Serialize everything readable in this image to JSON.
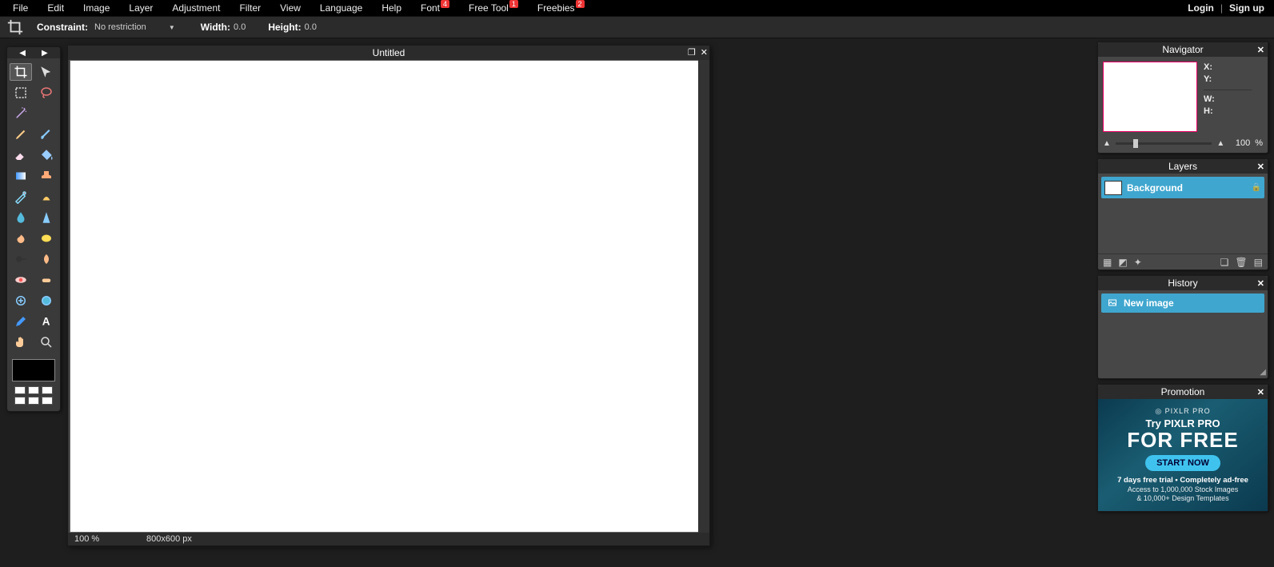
{
  "menu": {
    "items": [
      "File",
      "Edit",
      "Image",
      "Layer",
      "Adjustment",
      "Filter",
      "View",
      "Language",
      "Help"
    ],
    "font_label": "Font",
    "font_badge": "4",
    "freetool_label": "Free Tool",
    "freetool_badge": "1",
    "freebies_label": "Freebies",
    "freebies_badge": "2",
    "login": "Login",
    "signup": "Sign up"
  },
  "options": {
    "constraint_label": "Constraint:",
    "constraint_value": "No restriction",
    "width_label": "Width:",
    "width_value": "0.0",
    "height_label": "Height:",
    "height_value": "0.0"
  },
  "document": {
    "title": "Untitled",
    "zoom": "100",
    "zoom_unit": "%",
    "dimensions": "800x600 px"
  },
  "navigator": {
    "title": "Navigator",
    "x_label": "X:",
    "y_label": "Y:",
    "w_label": "W:",
    "h_label": "H:",
    "zoom": "100",
    "zoom_unit": "%"
  },
  "layers": {
    "title": "Layers",
    "items": [
      {
        "name": "Background",
        "locked": true
      }
    ]
  },
  "history": {
    "title": "History",
    "items": [
      {
        "name": "New image"
      }
    ]
  },
  "promotion": {
    "title": "Promotion",
    "brand": "◎ PIXLR PRO",
    "try_line": "Try PIXLR PRO",
    "free_line": "FOR FREE",
    "button": "START NOW",
    "line1": "7 days free trial  •  Completely ad-free",
    "line2": "Access to 1,000,000 Stock Images",
    "line3": "& 10,000+ Design Templates"
  }
}
